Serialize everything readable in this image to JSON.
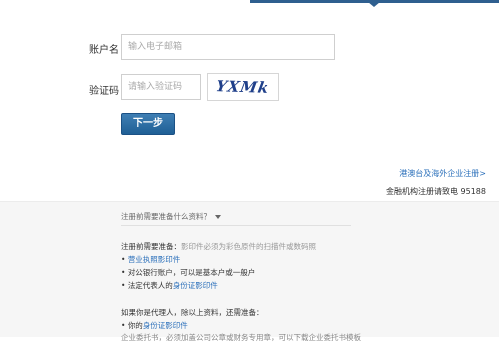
{
  "form": {
    "account_label": "账户名",
    "account_placeholder": "输入电子邮箱",
    "captcha_label": "验证码",
    "captcha_placeholder": "请输入验证码",
    "captcha_image_text": "YXMk",
    "next_button": "下一步"
  },
  "links": {
    "hk_overseas": "港澳台及海外企业注册>",
    "hotline": "金融机构注册请致电 95188"
  },
  "materials": {
    "toggle_label": "注册前需要准备什么资料？",
    "intro_prefix": "注册前需要准备：",
    "intro_note": "影印件必须为彩色原件的扫描件或数码照",
    "item1": "营业执照影印件",
    "item2": "对公银行账户，可以是基本户或一般户",
    "item3_prefix": "法定代表人的",
    "item3_link": "身份证影印件",
    "agent_intro": "如果你是代理人，除以上资料，还需准备：",
    "agent_item1_prefix": "你的",
    "agent_item1_link": "身份证影印件",
    "cut_line": "企业委托书，必须加盖公司公章或财务专用章，可以下载企业委托书模板"
  },
  "colors": {
    "accent": "#1f5f95",
    "link": "#2a6fba",
    "lower_background": "#f6f6f6"
  }
}
